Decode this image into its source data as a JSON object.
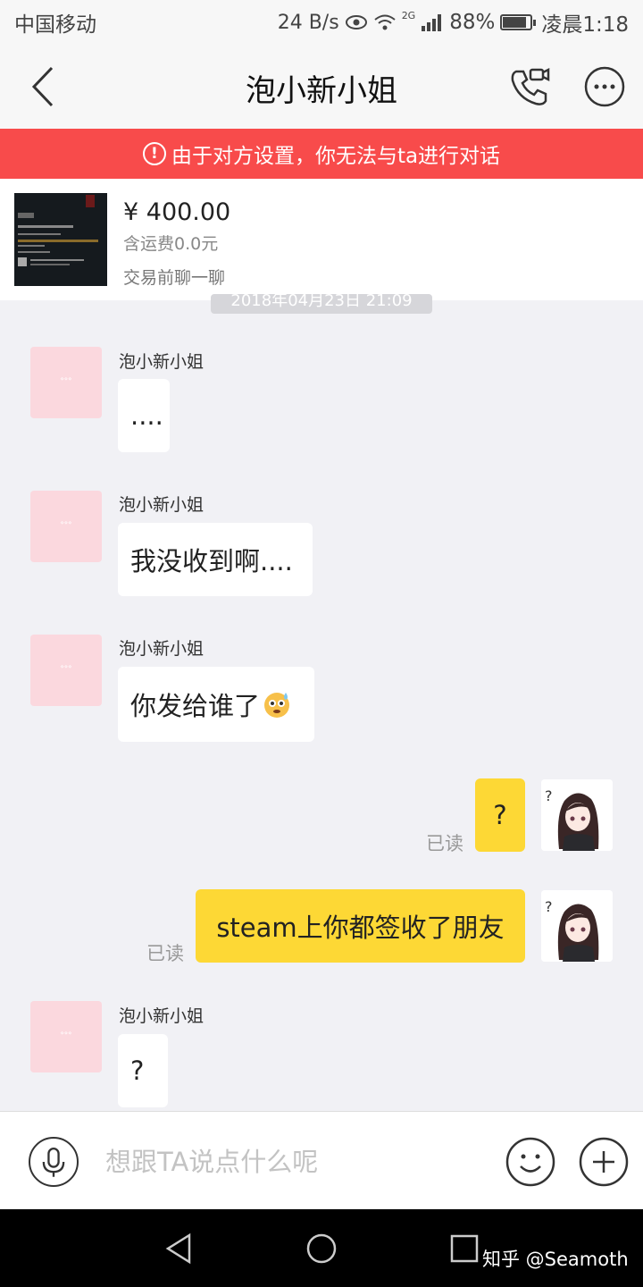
{
  "status_bar": {
    "carrier": "中国移动",
    "net_speed": "24 B/s",
    "signal": "2G",
    "battery": "88%",
    "battery_level": 0.88,
    "time": "凌晨1:18"
  },
  "header": {
    "title": "泡小新小姐",
    "icons": [
      "back-arrow-icon",
      "video-call-icon",
      "more-icon"
    ]
  },
  "notice": {
    "text": "由于对方设置，你无法与ta进行对话",
    "color": "#f84b4b"
  },
  "product": {
    "price": "¥ 400.00",
    "shipping": "含运费0.0元",
    "hint": "交易前聊一聊"
  },
  "timestamp": "2018年04月23日 21:09",
  "messages": [
    {
      "side": "other",
      "sender": "泡小新小姐",
      "text": "...."
    },
    {
      "side": "other",
      "sender": "泡小新小姐",
      "text": "我没收到啊...."
    },
    {
      "side": "other",
      "sender": "泡小新小姐",
      "text": "你发给谁了"
    },
    {
      "side": "me",
      "text": "?",
      "status": "已读"
    },
    {
      "side": "me",
      "text": "steam上你都签收了朋友",
      "status": "已读"
    },
    {
      "side": "other",
      "sender": "泡小新小姐",
      "text": "?"
    }
  ],
  "input": {
    "placeholder": "想跟TA说点什么呢"
  },
  "watermark": "知乎 @Seamoth",
  "colors": {
    "accent_yellow": "#fdd835",
    "chat_bg": "#f1f1f5"
  }
}
